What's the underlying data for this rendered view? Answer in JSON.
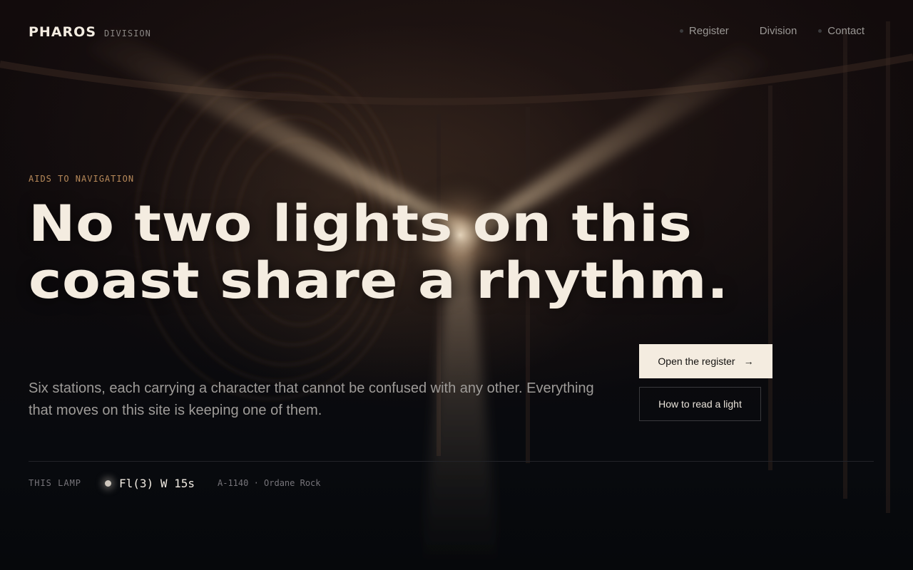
{
  "brand": {
    "name": "PHAROS",
    "sub": "DIVISION"
  },
  "nav": {
    "items": [
      {
        "label": "Register"
      },
      {
        "label": "Division"
      },
      {
        "label": "Contact"
      }
    ]
  },
  "hero": {
    "eyebrow": "AIDS TO NAVIGATION",
    "headline_line1": "No two lights on this",
    "headline_line2": "coast share a rhythm.",
    "lede": "Six stations, each carrying a character that cannot be confused with any other. Everything that moves on this site is keeping one of them.",
    "primary_button": "Open the register",
    "primary_arrow": "→",
    "secondary_button": "How to read a light"
  },
  "lamp": {
    "label": "THIS LAMP",
    "character": "Fl(3) W 15s",
    "meta": "A-1140 · Ordane Rock"
  },
  "colors": {
    "accent": "#b88a5a",
    "headline": "#f4ece0",
    "background": "#07080b"
  }
}
